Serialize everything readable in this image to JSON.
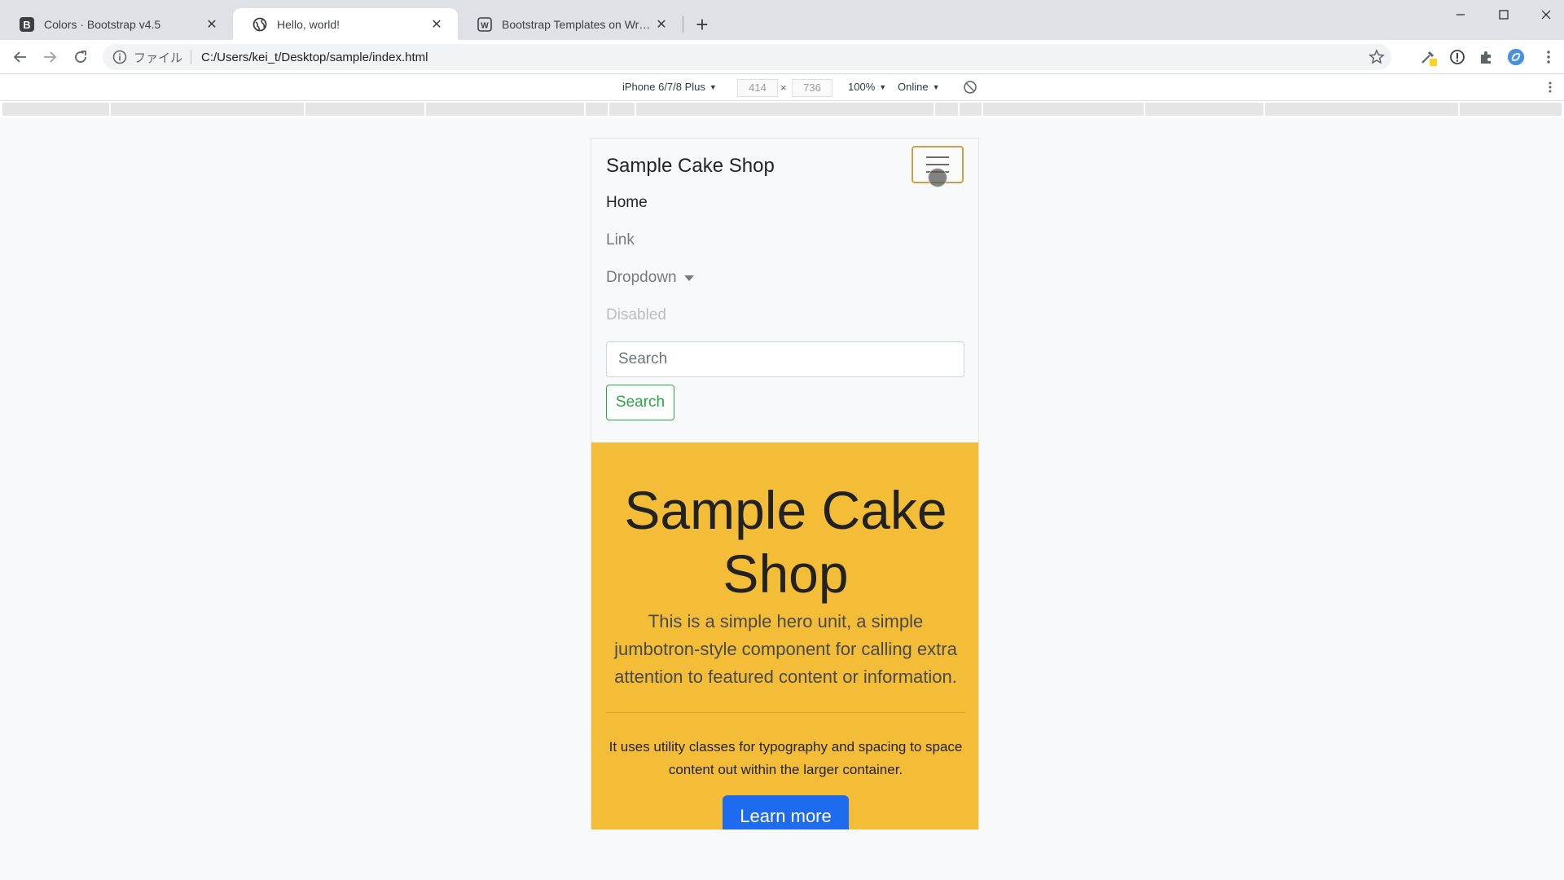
{
  "browser": {
    "tabs": [
      {
        "title": "Colors · Bootstrap v4.5",
        "icon": "bootstrap-icon",
        "active": false
      },
      {
        "title": "Hello, world!",
        "icon": "globe-icon",
        "active": true
      },
      {
        "title": "Bootstrap Templates on WrapBootstrap",
        "icon": "wrapbootstrap-icon",
        "active": false
      }
    ],
    "close_glyph": "✕",
    "newtab_glyph": "+",
    "address": {
      "file_label": "ファイル",
      "url": "C:/Users/kei_t/Desktop/sample/index.html"
    }
  },
  "devtools": {
    "device": "iPhone 6/7/8 Plus",
    "width": "414",
    "times": "×",
    "height": "736",
    "zoom": "100%",
    "network": "Online",
    "caret": "▼"
  },
  "page": {
    "brand": "Sample Cake Shop",
    "nav": {
      "home": "Home",
      "link": "Link",
      "dropdown": "Dropdown",
      "disabled": "Disabled"
    },
    "search": {
      "placeholder": "Search",
      "button": "Search"
    },
    "hero": {
      "title_line1": "Sample Cake",
      "title_line2": "Shop",
      "lead": "This is a simple hero unit, a simple jumbotron-style component for calling extra attention to featured content or information.",
      "body": "It uses utility classes for typography and spacing to space content out within the larger container.",
      "button": "Learn more"
    },
    "colors": {
      "hero_bg": "#f4bd37",
      "search_btn": "#28a745",
      "learn_btn": "#1f6bf0"
    }
  }
}
